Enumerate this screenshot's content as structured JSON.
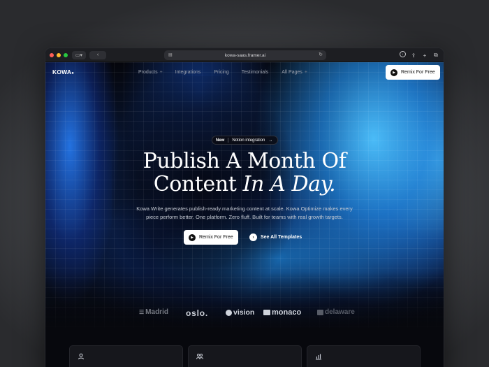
{
  "browser": {
    "url": "kowa-saas.framer.ai"
  },
  "nav": {
    "logo": "KOWA",
    "logo_mark": "●",
    "links": [
      {
        "label": "Products",
        "plus": "+"
      },
      {
        "label": "Integrations",
        "plus": ""
      },
      {
        "label": "Pricing",
        "plus": ""
      },
      {
        "label": "Testimonials",
        "plus": ""
      },
      {
        "label": "All Pages",
        "plus": "+"
      }
    ],
    "cta": "Remix For Free"
  },
  "hero": {
    "pill_tag": "New",
    "pill_text": "Notion integration",
    "pill_arrow": "→",
    "headline_1": "Publish A Month Of",
    "headline_2a": "Content ",
    "headline_2b": "In A Day.",
    "sub_1": "Kowa Write generates publish-ready marketing content at scale. Kowa Optimize makes every",
    "sub_2": "piece perform better. One platform. Zero fluff. Built for teams with real growth targets.",
    "cta_primary": "Remix For Free",
    "cta_secondary": "See All Templates"
  },
  "logos": [
    "Madrid",
    "oslo.",
    "vision",
    "monaco",
    "delaware"
  ],
  "colors": {
    "accent_blue": "#4ec3ff",
    "background": "#07080d",
    "button_bg": "#ffffff"
  },
  "icons": {
    "card1": "user-icon",
    "card2": "team-icon",
    "card3": "bar-chart-icon"
  }
}
